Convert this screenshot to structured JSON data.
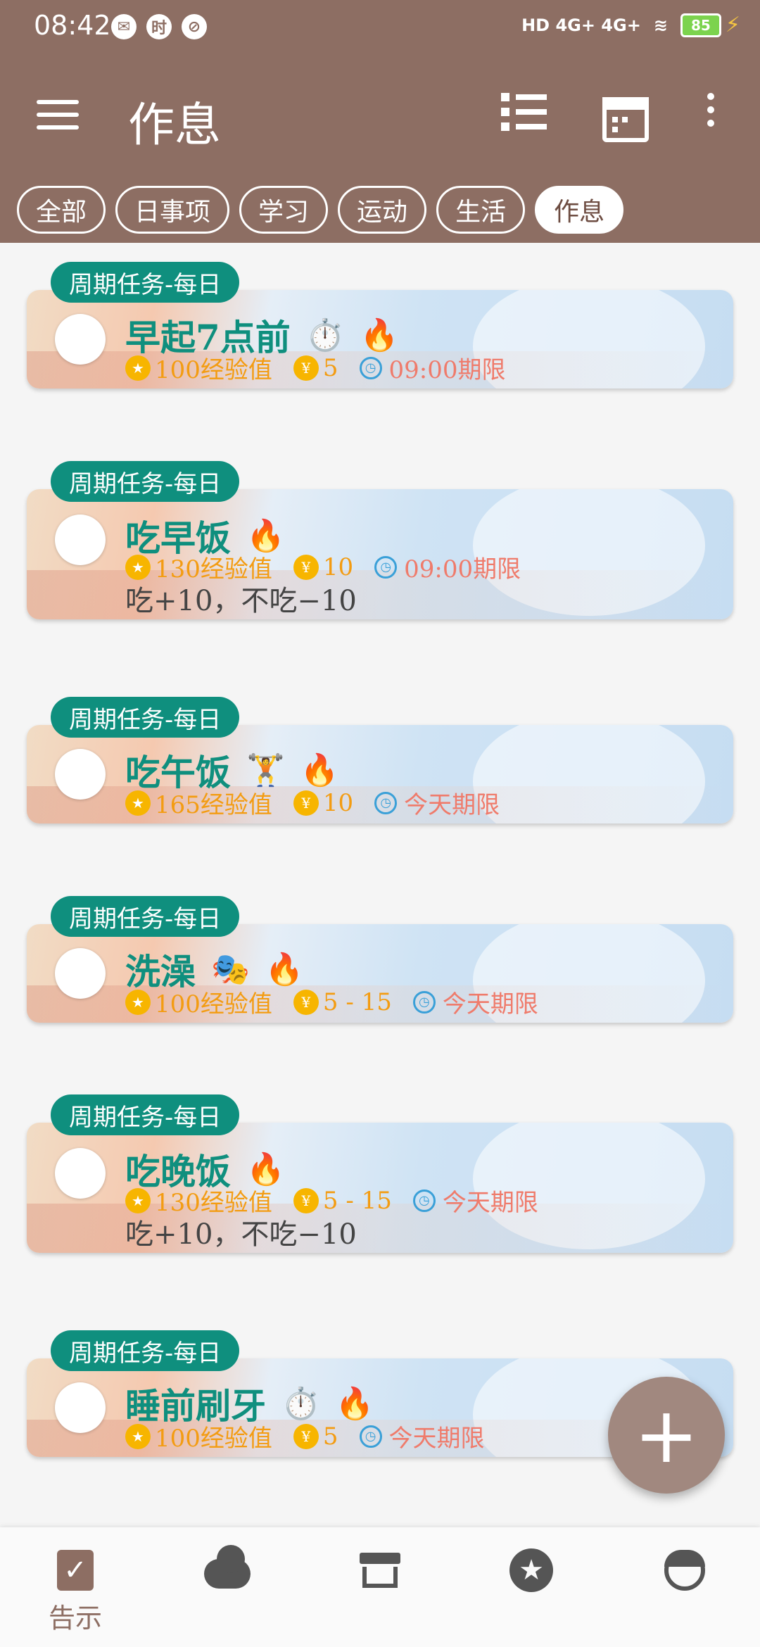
{
  "status_bar": {
    "time": "08:42",
    "network": "HD 4G+ 4G+",
    "battery": "85"
  },
  "app_bar": {
    "title": "作息"
  },
  "chips": [
    "全部",
    "日事项",
    "学习",
    "运动",
    "生活",
    "作息"
  ],
  "active_chip": "作息",
  "tasks": [
    {
      "tag": "周期任务-每日",
      "name": "早起7点前",
      "icons": [
        "stopwatch-icon",
        "fire-icon"
      ],
      "exp": "100经验值",
      "gold": "5",
      "deadline": "09:00期限",
      "note": ""
    },
    {
      "tag": "周期任务-每日",
      "name": "吃早饭",
      "icons": [
        "fire-icon"
      ],
      "exp": "130经验值",
      "gold": "10",
      "deadline": "09:00期限",
      "note": "吃+10，不吃−10"
    },
    {
      "tag": "周期任务-每日",
      "name": "吃午饭",
      "icons": [
        "dumbbell-icon",
        "fire-icon"
      ],
      "exp": "165经验值",
      "gold": "10",
      "deadline": "今天期限",
      "note": ""
    },
    {
      "tag": "周期任务-每日",
      "name": "洗澡",
      "icons": [
        "mask-icon",
        "fire-icon"
      ],
      "exp": "100经验值",
      "gold": "5 - 15",
      "deadline": "今天期限",
      "note": ""
    },
    {
      "tag": "周期任务-每日",
      "name": "吃晚饭",
      "icons": [
        "fire-icon"
      ],
      "exp": "130经验值",
      "gold": "5 - 15",
      "deadline": "今天期限",
      "note": "吃+10，不吃−10"
    },
    {
      "tag": "周期任务-每日",
      "name": "睡前刷牙",
      "icons": [
        "stopwatch-icon",
        "fire-icon"
      ],
      "exp": "100经验值",
      "gold": "5",
      "deadline": "今天期限",
      "note": ""
    }
  ],
  "bottom_nav": {
    "active_label": "告示",
    "items": [
      "clipboard-check-icon",
      "cloud-icon",
      "store-icon",
      "star-icon",
      "face-icon"
    ]
  },
  "colors": {
    "primary": "#8d6e63",
    "accent_teal": "#0f8f7e",
    "exp_orange": "#f39c12",
    "deadline_red": "#ef7b6b",
    "fab": "#a1887f"
  }
}
